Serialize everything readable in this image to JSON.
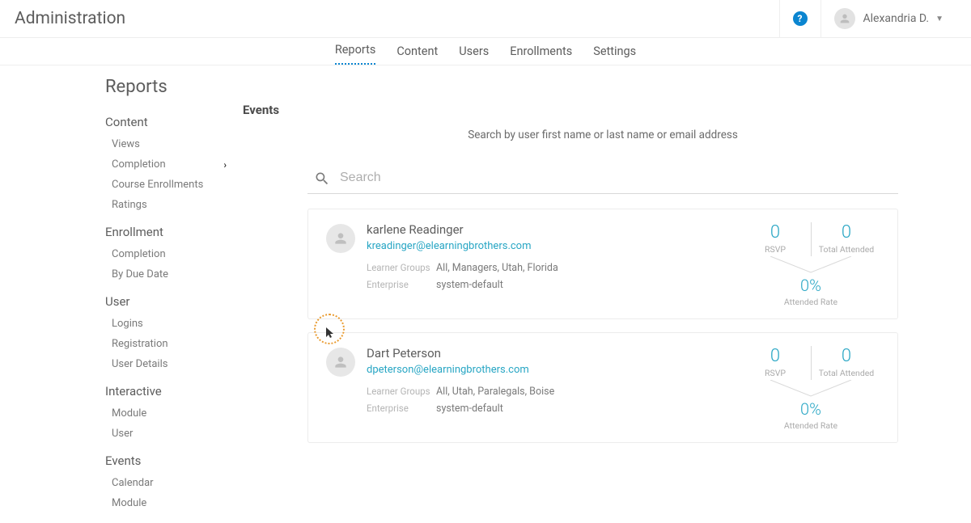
{
  "header": {
    "title": "Administration",
    "user": "Alexandria D."
  },
  "tabs": {
    "reports": "Reports",
    "content": "Content",
    "users": "Users",
    "enrollments": "Enrollments",
    "settings": "Settings"
  },
  "sidebar": {
    "title": "Reports",
    "groups": {
      "content": {
        "title": "Content",
        "views": "Views",
        "completion": "Completion",
        "course_enrollments": "Course Enrollments",
        "ratings": "Ratings"
      },
      "enrollment": {
        "title": "Enrollment",
        "completion": "Completion",
        "by_due_date": "By Due Date"
      },
      "user": {
        "title": "User",
        "logins": "Logins",
        "registration": "Registration",
        "user_details": "User Details"
      },
      "interactive": {
        "title": "Interactive",
        "module": "Module",
        "user": "User"
      },
      "events": {
        "title": "Events",
        "calendar": "Calendar",
        "module": "Module"
      }
    }
  },
  "main": {
    "heading": "Events",
    "hint": "Search by user first name or last name or email address",
    "search_placeholder": "Search",
    "meta_labels": {
      "groups": "Learner Groups",
      "enterprise": "Enterprise"
    },
    "stat_labels": {
      "rsvp": "RSVP",
      "total_attended": "Total Attended",
      "attended_rate": "Attended Rate"
    }
  },
  "results": [
    {
      "name": "karlene Readinger",
      "email": "kreadinger@elearningbrothers.com",
      "groups": "All, Managers, Utah, Florida",
      "enterprise": "system-default",
      "rsvp": "0",
      "total_attended": "0",
      "attended_rate": "0%"
    },
    {
      "name": "Dart Peterson",
      "email": "dpeterson@elearningbrothers.com",
      "groups": "All, Utah, Paralegals, Boise",
      "enterprise": "system-default",
      "rsvp": "0",
      "total_attended": "0",
      "attended_rate": "0%"
    }
  ]
}
